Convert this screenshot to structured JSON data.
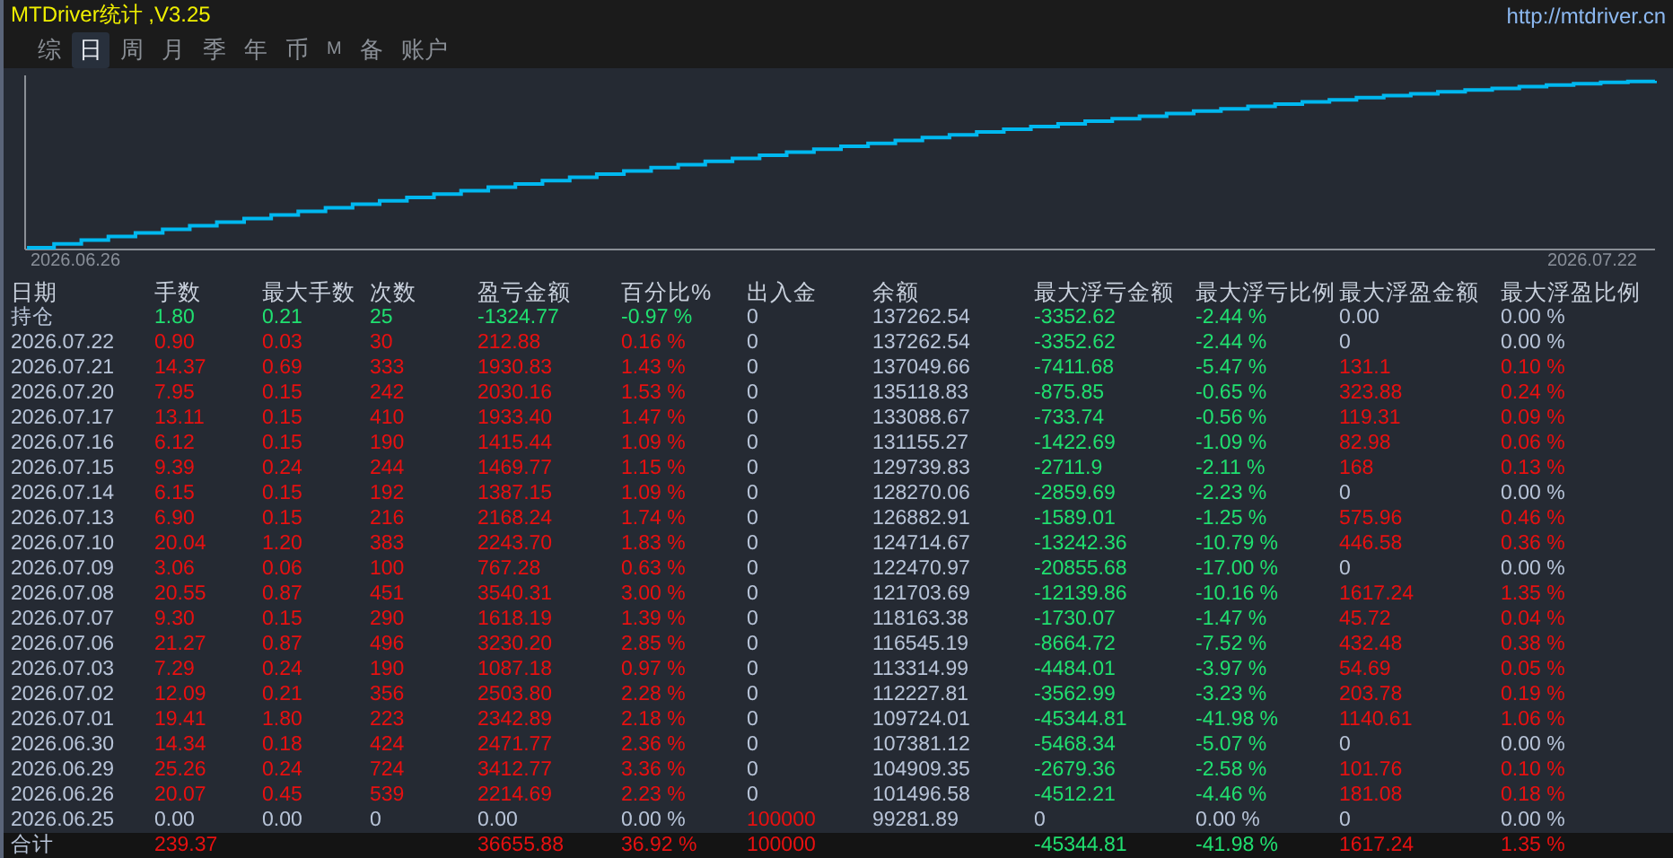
{
  "window": {
    "title": "MTDriver统计 ,V3.25",
    "url": "http://mtdriver.cn"
  },
  "tabs": [
    {
      "label": "综",
      "selected": false
    },
    {
      "label": "日",
      "selected": true
    },
    {
      "label": "周",
      "selected": false
    },
    {
      "label": "月",
      "selected": false
    },
    {
      "label": "季",
      "selected": false
    },
    {
      "label": "年",
      "selected": false
    },
    {
      "label": "币",
      "selected": false
    },
    {
      "label": "M",
      "selected": false
    },
    {
      "label": "备",
      "selected": false
    },
    {
      "label": "账户",
      "selected": false
    }
  ],
  "equity_curve": {
    "start_label": "2026.06.26",
    "end_label": "2026.07.22"
  },
  "table": {
    "columns": [
      "日期",
      "手数",
      "最大手数",
      "次数",
      "盈亏金额",
      "百分比%",
      "出入金",
      "余额",
      "最大浮亏金额",
      "最大浮亏比例",
      "最大浮盈金额",
      "最大浮盈比例"
    ],
    "rows": [
      {
        "cells": [
          {
            "text": "持仓",
            "color": "#b8c4d8"
          },
          {
            "text": "1.80",
            "color": "#20e070"
          },
          {
            "text": "0.21",
            "color": "#20e070"
          },
          {
            "text": "25",
            "color": "#20e070"
          },
          {
            "text": "-1324.77",
            "color": "#20e070"
          },
          {
            "text": "-0.97 %",
            "color": "#20e070"
          },
          {
            "text": "0",
            "color": "#b8c4d8"
          },
          {
            "text": "137262.54",
            "color": "#b8c4d8"
          },
          {
            "text": "-3352.62",
            "color": "#20e070"
          },
          {
            "text": "-2.44 %",
            "color": "#20e070"
          },
          {
            "text": "0.00",
            "color": "#b8c4d8"
          },
          {
            "text": "0.00 %",
            "color": "#b8c4d8"
          }
        ]
      },
      {
        "cells": [
          {
            "text": "2026.07.22",
            "color": "#b8c4d8"
          },
          {
            "text": "0.90",
            "color": "#e81010"
          },
          {
            "text": "0.03",
            "color": "#e81010"
          },
          {
            "text": "30",
            "color": "#e81010"
          },
          {
            "text": "212.88",
            "color": "#e81010"
          },
          {
            "text": "0.16 %",
            "color": "#e81010"
          },
          {
            "text": "0",
            "color": "#b8c4d8"
          },
          {
            "text": "137262.54",
            "color": "#b8c4d8"
          },
          {
            "text": "-3352.62",
            "color": "#20e070"
          },
          {
            "text": "-2.44 %",
            "color": "#20e070"
          },
          {
            "text": "0",
            "color": "#b8c4d8"
          },
          {
            "text": "0.00 %",
            "color": "#b8c4d8"
          }
        ]
      },
      {
        "cells": [
          {
            "text": "2026.07.21",
            "color": "#b8c4d8"
          },
          {
            "text": "14.37",
            "color": "#e81010"
          },
          {
            "text": "0.69",
            "color": "#e81010"
          },
          {
            "text": "333",
            "color": "#e81010"
          },
          {
            "text": "1930.83",
            "color": "#e81010"
          },
          {
            "text": "1.43 %",
            "color": "#e81010"
          },
          {
            "text": "0",
            "color": "#b8c4d8"
          },
          {
            "text": "137049.66",
            "color": "#b8c4d8"
          },
          {
            "text": "-7411.68",
            "color": "#20e070"
          },
          {
            "text": "-5.47 %",
            "color": "#20e070"
          },
          {
            "text": "131.1",
            "color": "#e81010"
          },
          {
            "text": "0.10 %",
            "color": "#e81010"
          }
        ]
      },
      {
        "cells": [
          {
            "text": "2026.07.20",
            "color": "#b8c4d8"
          },
          {
            "text": "7.95",
            "color": "#e81010"
          },
          {
            "text": "0.15",
            "color": "#e81010"
          },
          {
            "text": "242",
            "color": "#e81010"
          },
          {
            "text": "2030.16",
            "color": "#e81010"
          },
          {
            "text": "1.53 %",
            "color": "#e81010"
          },
          {
            "text": "0",
            "color": "#b8c4d8"
          },
          {
            "text": "135118.83",
            "color": "#b8c4d8"
          },
          {
            "text": "-875.85",
            "color": "#20e070"
          },
          {
            "text": "-0.65 %",
            "color": "#20e070"
          },
          {
            "text": "323.88",
            "color": "#e81010"
          },
          {
            "text": "0.24 %",
            "color": "#e81010"
          }
        ]
      },
      {
        "cells": [
          {
            "text": "2026.07.17",
            "color": "#b8c4d8"
          },
          {
            "text": "13.11",
            "color": "#e81010"
          },
          {
            "text": "0.15",
            "color": "#e81010"
          },
          {
            "text": "410",
            "color": "#e81010"
          },
          {
            "text": "1933.40",
            "color": "#e81010"
          },
          {
            "text": "1.47 %",
            "color": "#e81010"
          },
          {
            "text": "0",
            "color": "#b8c4d8"
          },
          {
            "text": "133088.67",
            "color": "#b8c4d8"
          },
          {
            "text": "-733.74",
            "color": "#20e070"
          },
          {
            "text": "-0.56 %",
            "color": "#20e070"
          },
          {
            "text": "119.31",
            "color": "#e81010"
          },
          {
            "text": "0.09 %",
            "color": "#e81010"
          }
        ]
      },
      {
        "cells": [
          {
            "text": "2026.07.16",
            "color": "#b8c4d8"
          },
          {
            "text": "6.12",
            "color": "#e81010"
          },
          {
            "text": "0.15",
            "color": "#e81010"
          },
          {
            "text": "190",
            "color": "#e81010"
          },
          {
            "text": "1415.44",
            "color": "#e81010"
          },
          {
            "text": "1.09 %",
            "color": "#e81010"
          },
          {
            "text": "0",
            "color": "#b8c4d8"
          },
          {
            "text": "131155.27",
            "color": "#b8c4d8"
          },
          {
            "text": "-1422.69",
            "color": "#20e070"
          },
          {
            "text": "-1.09 %",
            "color": "#20e070"
          },
          {
            "text": "82.98",
            "color": "#e81010"
          },
          {
            "text": "0.06 %",
            "color": "#e81010"
          }
        ]
      },
      {
        "cells": [
          {
            "text": "2026.07.15",
            "color": "#b8c4d8"
          },
          {
            "text": "9.39",
            "color": "#e81010"
          },
          {
            "text": "0.24",
            "color": "#e81010"
          },
          {
            "text": "244",
            "color": "#e81010"
          },
          {
            "text": "1469.77",
            "color": "#e81010"
          },
          {
            "text": "1.15 %",
            "color": "#e81010"
          },
          {
            "text": "0",
            "color": "#b8c4d8"
          },
          {
            "text": "129739.83",
            "color": "#b8c4d8"
          },
          {
            "text": "-2711.9",
            "color": "#20e070"
          },
          {
            "text": "-2.11 %",
            "color": "#20e070"
          },
          {
            "text": "168",
            "color": "#e81010"
          },
          {
            "text": "0.13 %",
            "color": "#e81010"
          }
        ]
      },
      {
        "cells": [
          {
            "text": "2026.07.14",
            "color": "#b8c4d8"
          },
          {
            "text": "6.15",
            "color": "#e81010"
          },
          {
            "text": "0.15",
            "color": "#e81010"
          },
          {
            "text": "192",
            "color": "#e81010"
          },
          {
            "text": "1387.15",
            "color": "#e81010"
          },
          {
            "text": "1.09 %",
            "color": "#e81010"
          },
          {
            "text": "0",
            "color": "#b8c4d8"
          },
          {
            "text": "128270.06",
            "color": "#b8c4d8"
          },
          {
            "text": "-2859.69",
            "color": "#20e070"
          },
          {
            "text": "-2.23 %",
            "color": "#20e070"
          },
          {
            "text": "0",
            "color": "#b8c4d8"
          },
          {
            "text": "0.00 %",
            "color": "#b8c4d8"
          }
        ]
      },
      {
        "cells": [
          {
            "text": "2026.07.13",
            "color": "#b8c4d8"
          },
          {
            "text": "6.90",
            "color": "#e81010"
          },
          {
            "text": "0.15",
            "color": "#e81010"
          },
          {
            "text": "216",
            "color": "#e81010"
          },
          {
            "text": "2168.24",
            "color": "#e81010"
          },
          {
            "text": "1.74 %",
            "color": "#e81010"
          },
          {
            "text": "0",
            "color": "#b8c4d8"
          },
          {
            "text": "126882.91",
            "color": "#b8c4d8"
          },
          {
            "text": "-1589.01",
            "color": "#20e070"
          },
          {
            "text": "-1.25 %",
            "color": "#20e070"
          },
          {
            "text": "575.96",
            "color": "#e81010"
          },
          {
            "text": "0.46 %",
            "color": "#e81010"
          }
        ]
      },
      {
        "cells": [
          {
            "text": "2026.07.10",
            "color": "#b8c4d8"
          },
          {
            "text": "20.04",
            "color": "#e81010"
          },
          {
            "text": "1.20",
            "color": "#e81010"
          },
          {
            "text": "383",
            "color": "#e81010"
          },
          {
            "text": "2243.70",
            "color": "#e81010"
          },
          {
            "text": "1.83 %",
            "color": "#e81010"
          },
          {
            "text": "0",
            "color": "#b8c4d8"
          },
          {
            "text": "124714.67",
            "color": "#b8c4d8"
          },
          {
            "text": "-13242.36",
            "color": "#20e070"
          },
          {
            "text": "-10.79 %",
            "color": "#20e070"
          },
          {
            "text": "446.58",
            "color": "#e81010"
          },
          {
            "text": "0.36 %",
            "color": "#e81010"
          }
        ]
      },
      {
        "cells": [
          {
            "text": "2026.07.09",
            "color": "#b8c4d8"
          },
          {
            "text": "3.06",
            "color": "#e81010"
          },
          {
            "text": "0.06",
            "color": "#e81010"
          },
          {
            "text": "100",
            "color": "#e81010"
          },
          {
            "text": "767.28",
            "color": "#e81010"
          },
          {
            "text": "0.63 %",
            "color": "#e81010"
          },
          {
            "text": "0",
            "color": "#b8c4d8"
          },
          {
            "text": "122470.97",
            "color": "#b8c4d8"
          },
          {
            "text": "-20855.68",
            "color": "#20e070"
          },
          {
            "text": "-17.00 %",
            "color": "#20e070"
          },
          {
            "text": "0",
            "color": "#b8c4d8"
          },
          {
            "text": "0.00 %",
            "color": "#b8c4d8"
          }
        ]
      },
      {
        "cells": [
          {
            "text": "2026.07.08",
            "color": "#b8c4d8"
          },
          {
            "text": "20.55",
            "color": "#e81010"
          },
          {
            "text": "0.87",
            "color": "#e81010"
          },
          {
            "text": "451",
            "color": "#e81010"
          },
          {
            "text": "3540.31",
            "color": "#e81010"
          },
          {
            "text": "3.00 %",
            "color": "#e81010"
          },
          {
            "text": "0",
            "color": "#b8c4d8"
          },
          {
            "text": "121703.69",
            "color": "#b8c4d8"
          },
          {
            "text": "-12139.86",
            "color": "#20e070"
          },
          {
            "text": "-10.16 %",
            "color": "#20e070"
          },
          {
            "text": "1617.24",
            "color": "#e81010"
          },
          {
            "text": "1.35 %",
            "color": "#e81010"
          }
        ]
      },
      {
        "cells": [
          {
            "text": "2026.07.07",
            "color": "#b8c4d8"
          },
          {
            "text": "9.30",
            "color": "#e81010"
          },
          {
            "text": "0.15",
            "color": "#e81010"
          },
          {
            "text": "290",
            "color": "#e81010"
          },
          {
            "text": "1618.19",
            "color": "#e81010"
          },
          {
            "text": "1.39 %",
            "color": "#e81010"
          },
          {
            "text": "0",
            "color": "#b8c4d8"
          },
          {
            "text": "118163.38",
            "color": "#b8c4d8"
          },
          {
            "text": "-1730.07",
            "color": "#20e070"
          },
          {
            "text": "-1.47 %",
            "color": "#20e070"
          },
          {
            "text": "45.72",
            "color": "#e81010"
          },
          {
            "text": "0.04 %",
            "color": "#e81010"
          }
        ]
      },
      {
        "cells": [
          {
            "text": "2026.07.06",
            "color": "#b8c4d8"
          },
          {
            "text": "21.27",
            "color": "#e81010"
          },
          {
            "text": "0.87",
            "color": "#e81010"
          },
          {
            "text": "496",
            "color": "#e81010"
          },
          {
            "text": "3230.20",
            "color": "#e81010"
          },
          {
            "text": "2.85 %",
            "color": "#e81010"
          },
          {
            "text": "0",
            "color": "#b8c4d8"
          },
          {
            "text": "116545.19",
            "color": "#b8c4d8"
          },
          {
            "text": "-8664.72",
            "color": "#20e070"
          },
          {
            "text": "-7.52 %",
            "color": "#20e070"
          },
          {
            "text": "432.48",
            "color": "#e81010"
          },
          {
            "text": "0.38 %",
            "color": "#e81010"
          }
        ]
      },
      {
        "cells": [
          {
            "text": "2026.07.03",
            "color": "#b8c4d8"
          },
          {
            "text": "7.29",
            "color": "#e81010"
          },
          {
            "text": "0.24",
            "color": "#e81010"
          },
          {
            "text": "190",
            "color": "#e81010"
          },
          {
            "text": "1087.18",
            "color": "#e81010"
          },
          {
            "text": "0.97 %",
            "color": "#e81010"
          },
          {
            "text": "0",
            "color": "#b8c4d8"
          },
          {
            "text": "113314.99",
            "color": "#b8c4d8"
          },
          {
            "text": "-4484.01",
            "color": "#20e070"
          },
          {
            "text": "-3.97 %",
            "color": "#20e070"
          },
          {
            "text": "54.69",
            "color": "#e81010"
          },
          {
            "text": "0.05 %",
            "color": "#e81010"
          }
        ]
      },
      {
        "cells": [
          {
            "text": "2026.07.02",
            "color": "#b8c4d8"
          },
          {
            "text": "12.09",
            "color": "#e81010"
          },
          {
            "text": "0.21",
            "color": "#e81010"
          },
          {
            "text": "356",
            "color": "#e81010"
          },
          {
            "text": "2503.80",
            "color": "#e81010"
          },
          {
            "text": "2.28 %",
            "color": "#e81010"
          },
          {
            "text": "0",
            "color": "#b8c4d8"
          },
          {
            "text": "112227.81",
            "color": "#b8c4d8"
          },
          {
            "text": "-3562.99",
            "color": "#20e070"
          },
          {
            "text": "-3.23 %",
            "color": "#20e070"
          },
          {
            "text": "203.78",
            "color": "#e81010"
          },
          {
            "text": "0.19 %",
            "color": "#e81010"
          }
        ]
      },
      {
        "cells": [
          {
            "text": "2026.07.01",
            "color": "#b8c4d8"
          },
          {
            "text": "19.41",
            "color": "#e81010"
          },
          {
            "text": "1.80",
            "color": "#e81010"
          },
          {
            "text": "223",
            "color": "#e81010"
          },
          {
            "text": "2342.89",
            "color": "#e81010"
          },
          {
            "text": "2.18 %",
            "color": "#e81010"
          },
          {
            "text": "0",
            "color": "#b8c4d8"
          },
          {
            "text": "109724.01",
            "color": "#b8c4d8"
          },
          {
            "text": "-45344.81",
            "color": "#20e070"
          },
          {
            "text": "-41.98 %",
            "color": "#20e070"
          },
          {
            "text": "1140.61",
            "color": "#e81010"
          },
          {
            "text": "1.06 %",
            "color": "#e81010"
          }
        ]
      },
      {
        "cells": [
          {
            "text": "2026.06.30",
            "color": "#b8c4d8"
          },
          {
            "text": "14.34",
            "color": "#e81010"
          },
          {
            "text": "0.18",
            "color": "#e81010"
          },
          {
            "text": "424",
            "color": "#e81010"
          },
          {
            "text": "2471.77",
            "color": "#e81010"
          },
          {
            "text": "2.36 %",
            "color": "#e81010"
          },
          {
            "text": "0",
            "color": "#b8c4d8"
          },
          {
            "text": "107381.12",
            "color": "#b8c4d8"
          },
          {
            "text": "-5468.34",
            "color": "#20e070"
          },
          {
            "text": "-5.07 %",
            "color": "#20e070"
          },
          {
            "text": "0",
            "color": "#b8c4d8"
          },
          {
            "text": "0.00 %",
            "color": "#b8c4d8"
          }
        ]
      },
      {
        "cells": [
          {
            "text": "2026.06.29",
            "color": "#b8c4d8"
          },
          {
            "text": "25.26",
            "color": "#e81010"
          },
          {
            "text": "0.24",
            "color": "#e81010"
          },
          {
            "text": "724",
            "color": "#e81010"
          },
          {
            "text": "3412.77",
            "color": "#e81010"
          },
          {
            "text": "3.36 %",
            "color": "#e81010"
          },
          {
            "text": "0",
            "color": "#b8c4d8"
          },
          {
            "text": "104909.35",
            "color": "#b8c4d8"
          },
          {
            "text": "-2679.36",
            "color": "#20e070"
          },
          {
            "text": "-2.58 %",
            "color": "#20e070"
          },
          {
            "text": "101.76",
            "color": "#e81010"
          },
          {
            "text": "0.10 %",
            "color": "#e81010"
          }
        ]
      },
      {
        "cells": [
          {
            "text": "2026.06.26",
            "color": "#b8c4d8"
          },
          {
            "text": "20.07",
            "color": "#e81010"
          },
          {
            "text": "0.45",
            "color": "#e81010"
          },
          {
            "text": "539",
            "color": "#e81010"
          },
          {
            "text": "2214.69",
            "color": "#e81010"
          },
          {
            "text": "2.23 %",
            "color": "#e81010"
          },
          {
            "text": "0",
            "color": "#b8c4d8"
          },
          {
            "text": "101496.58",
            "color": "#b8c4d8"
          },
          {
            "text": "-4512.21",
            "color": "#20e070"
          },
          {
            "text": "-4.46 %",
            "color": "#20e070"
          },
          {
            "text": "181.08",
            "color": "#e81010"
          },
          {
            "text": "0.18 %",
            "color": "#e81010"
          }
        ]
      },
      {
        "cells": [
          {
            "text": "2026.06.25",
            "color": "#b8c4d8"
          },
          {
            "text": "0.00",
            "color": "#b8c4d8"
          },
          {
            "text": "0.00",
            "color": "#b8c4d8"
          },
          {
            "text": "0",
            "color": "#b8c4d8"
          },
          {
            "text": "0.00",
            "color": "#b8c4d8"
          },
          {
            "text": "0.00 %",
            "color": "#b8c4d8"
          },
          {
            "text": "100000",
            "color": "#e81010"
          },
          {
            "text": "99281.89",
            "color": "#b8c4d8"
          },
          {
            "text": "0",
            "color": "#b8c4d8"
          },
          {
            "text": "0.00 %",
            "color": "#b8c4d8"
          },
          {
            "text": "0",
            "color": "#b8c4d8"
          },
          {
            "text": "0.00 %",
            "color": "#b8c4d8"
          }
        ]
      }
    ],
    "totals": {
      "date": {
        "text": "合计",
        "color": "#b8c4d8"
      },
      "lots": {
        "text": "239.37",
        "color": "#e81010"
      },
      "pnl": {
        "text": "36655.88",
        "color": "#e81010"
      },
      "percent": {
        "text": "36.92 %",
        "color": "#e81010"
      },
      "deposit": {
        "text": "100000",
        "color": "#e81010"
      },
      "max_drawdown": {
        "text": "-45344.81",
        "color": "#20e070"
      },
      "max_drawdown_percent": {
        "text": "-41.98 %",
        "color": "#20e070"
      },
      "max_float_profit": {
        "text": "1617.24",
        "color": "#e81010"
      },
      "max_float_profit_percent": {
        "text": "1.35 %",
        "color": "#e81010"
      }
    }
  }
}
